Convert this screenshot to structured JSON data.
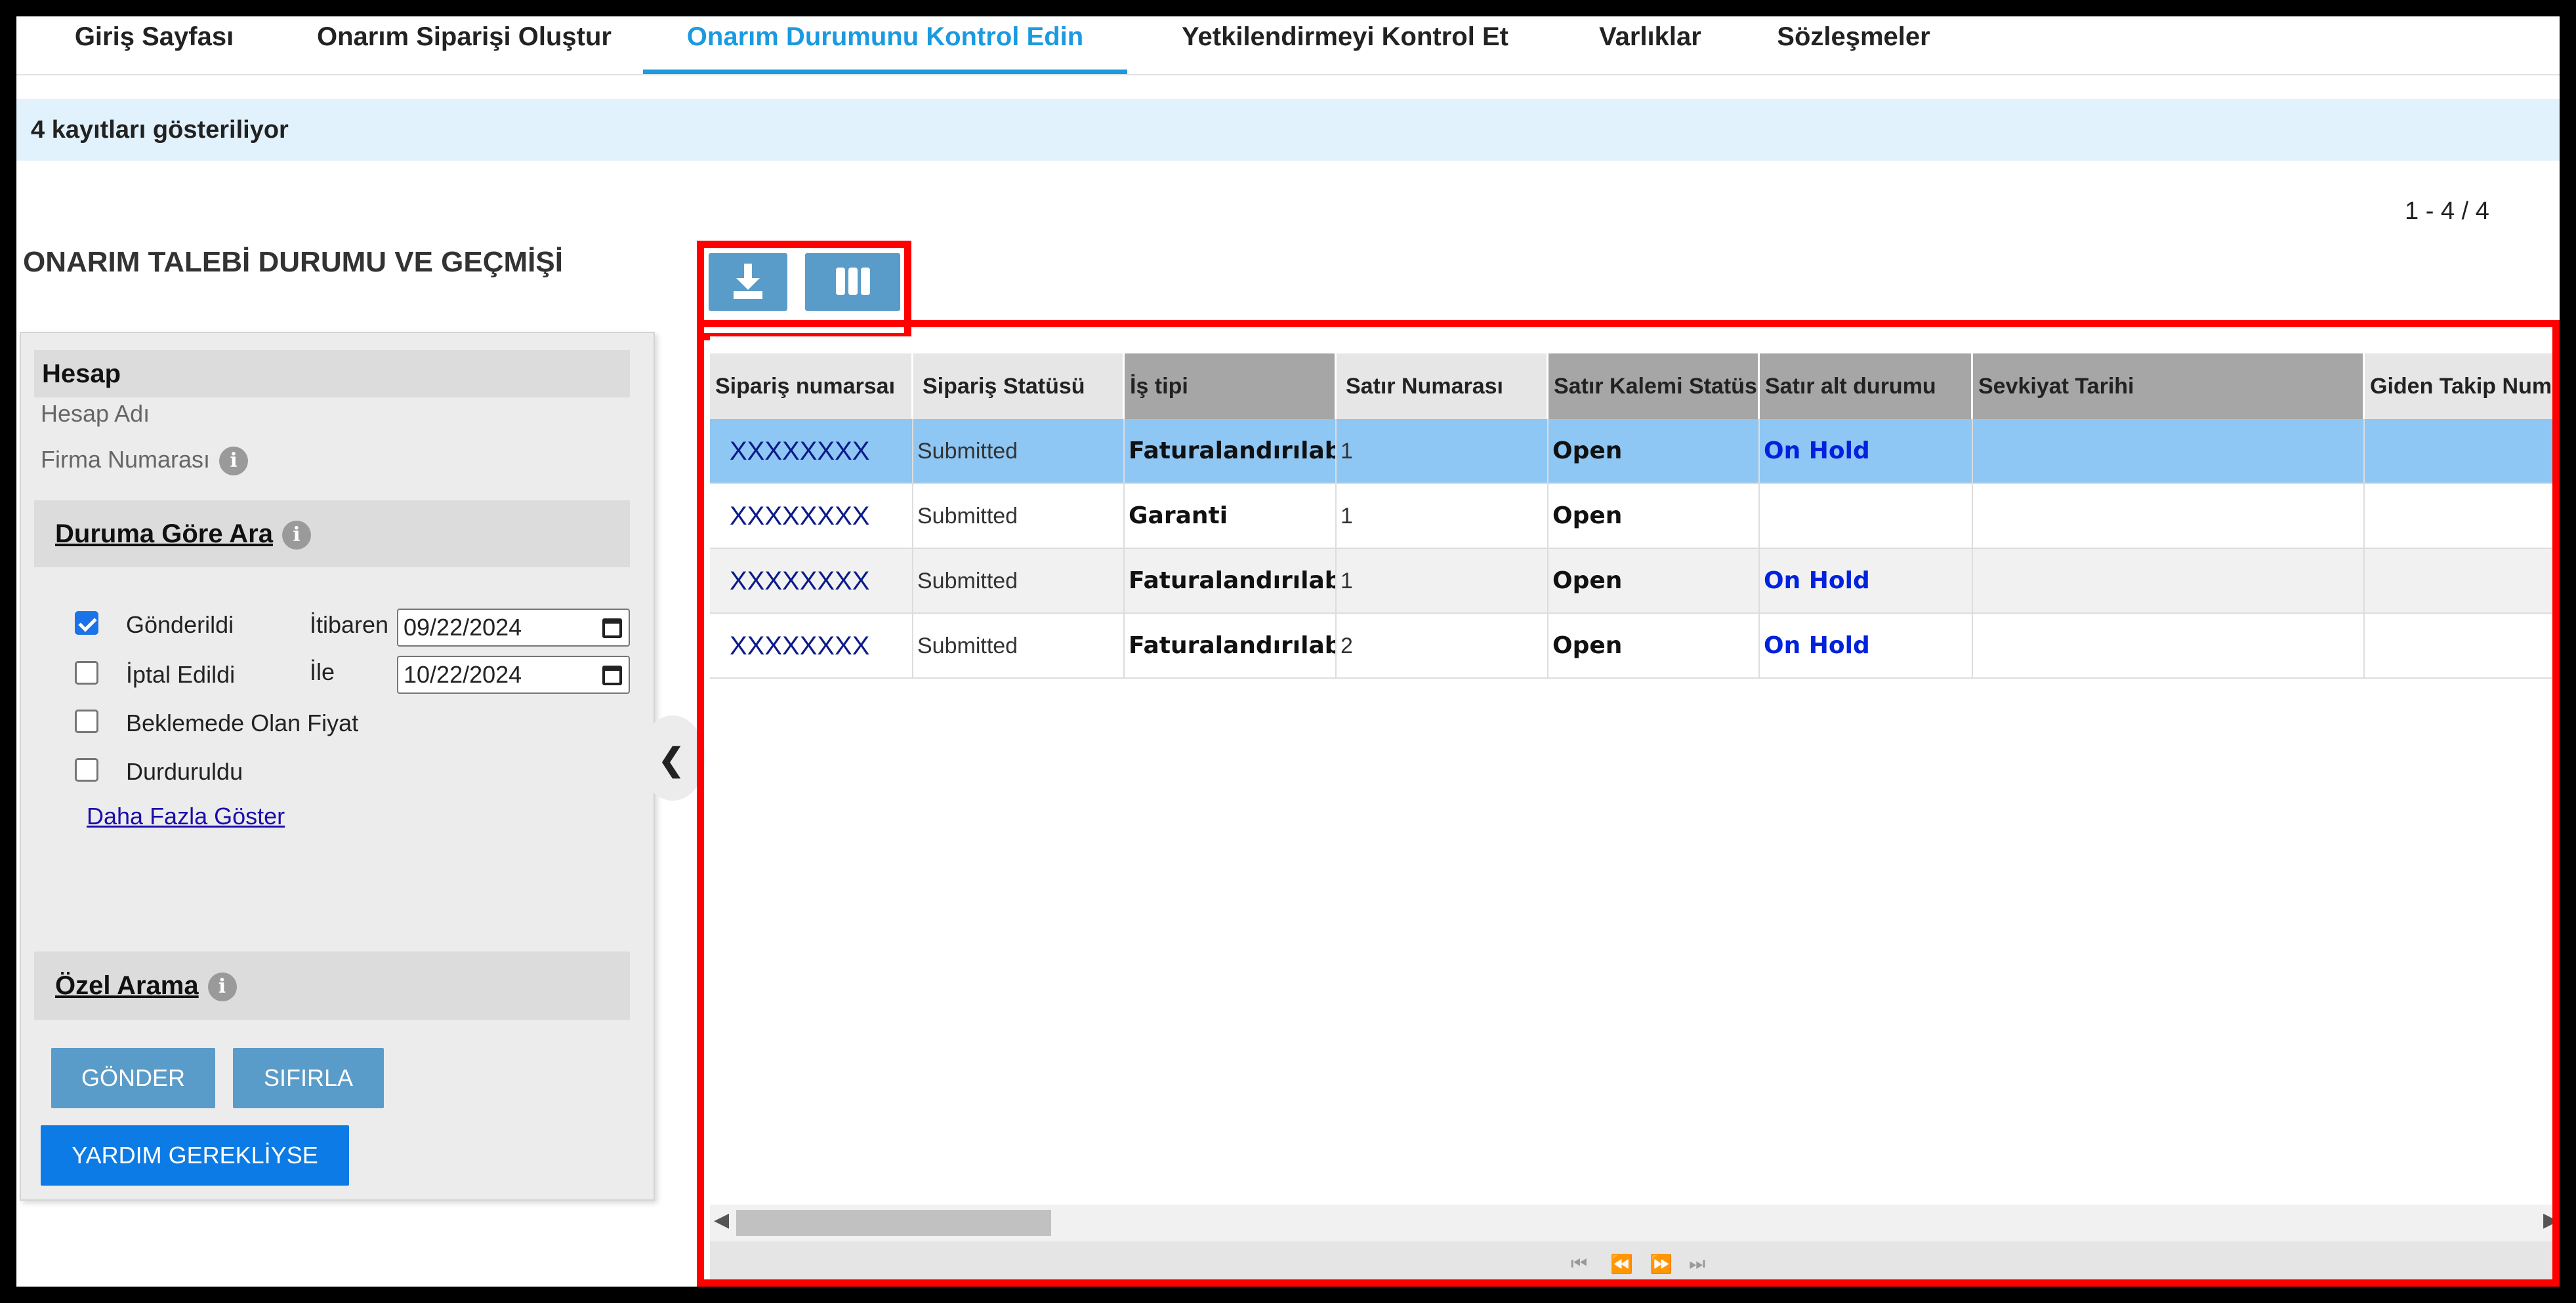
{
  "nav": {
    "tabs": [
      {
        "label": "Giriş Sayfası"
      },
      {
        "label": "Onarım Siparişi Oluştur"
      },
      {
        "label": "Onarım Durumunu Kontrol Edin"
      },
      {
        "label": "Yetkilendirmeyi Kontrol Et"
      },
      {
        "label": "Varlıklar"
      },
      {
        "label": "Sözleşmeler"
      }
    ],
    "active_tab": "Onarım Durumunu Kontrol Edin"
  },
  "info_bar": {
    "text": "4 kayıtları gösteriliyor"
  },
  "pagination": {
    "range": "1 - 4 / 4"
  },
  "page_title": "ONARIM TALEBİ DURUMU VE GEÇMİŞİ",
  "left_panel": {
    "account": {
      "heading": "Hesap",
      "account_name_label": "Hesap Adı",
      "company_number_label": "Firma Numarası"
    },
    "status_search": {
      "heading": "Duruma Göre Ara",
      "filters": [
        {
          "label": "Gönderildi",
          "checked": true
        },
        {
          "label": "İptal Edildi",
          "checked": false
        },
        {
          "label": "Beklemede Olan Fiyat",
          "checked": false
        },
        {
          "label": "Durduruldu",
          "checked": false
        }
      ],
      "from_label": "İtibaren",
      "from_value": "09/22/2024",
      "to_label": "İle",
      "to_value": "10/22/2024",
      "more_link": "Daha Fazla Göster"
    },
    "custom_search": {
      "heading": "Özel Arama"
    },
    "buttons": {
      "submit": "GÖNDER",
      "reset": "SIFIRLA",
      "help": "YARDIM GEREKLİYSE"
    }
  },
  "toolbar": {
    "download_icon": "download-icon",
    "columns_icon": "columns-icon"
  },
  "grid": {
    "columns": [
      "Sipariş numarsaı",
      "Sipariş Statüsü",
      "İş tipi",
      "Satır Numarası",
      "Satır Kalemi Statüsü",
      "Satır alt durumu",
      "Sevkiyat Tarihi",
      "Giden Takip Numarası"
    ],
    "rows": [
      {
        "order": "XXXXXXXX",
        "status": "Submitted",
        "job_type": "Faturalandırılabilir",
        "line_no": "1",
        "line_status": "Open",
        "sub_status": "On Hold",
        "ship_date": "",
        "tracking": ""
      },
      {
        "order": "XXXXXXXX",
        "status": "Submitted",
        "job_type": "Garanti",
        "line_no": "1",
        "line_status": "Open",
        "sub_status": "",
        "ship_date": "",
        "tracking": ""
      },
      {
        "order": "XXXXXXXX",
        "status": "Submitted",
        "job_type": "Faturalandırılabilir",
        "line_no": "1",
        "line_status": "Open",
        "sub_status": "On Hold",
        "ship_date": "",
        "tracking": ""
      },
      {
        "order": "XXXXXXXX",
        "status": "Submitted",
        "job_type": "Faturalandırılabilir",
        "line_no": "2",
        "line_status": "Open",
        "sub_status": "On Hold",
        "ship_date": "",
        "tracking": ""
      }
    ]
  },
  "colors": {
    "accent": "#1a9ae0",
    "highlight_frame": "#ff0000",
    "selected_row": "#8ec6f4",
    "info_bar": "#e2f2fc",
    "on_hold_text": "#0022dd"
  }
}
